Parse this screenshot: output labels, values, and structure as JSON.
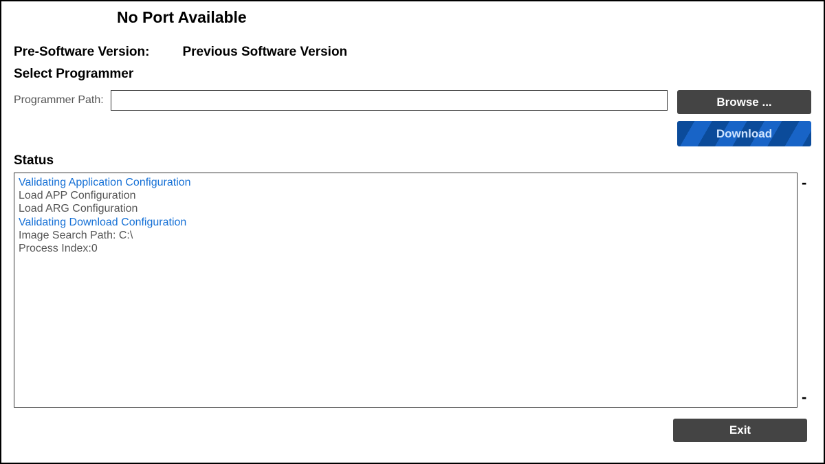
{
  "port_title": "No Port Available",
  "version": {
    "label": "Pre-Software Version:",
    "value": "Previous Software Version"
  },
  "select_programmer": {
    "heading": "Select Programmer",
    "path_label": "Programmer Path:",
    "path_value": ""
  },
  "buttons": {
    "browse": "Browse ...",
    "download": "Download",
    "exit": "Exit"
  },
  "status": {
    "heading": "Status",
    "lines": [
      {
        "text": "Validating Application Configuration",
        "highlight": true
      },
      {
        "text": "Load APP Configuration",
        "highlight": false
      },
      {
        "text": "Load ARG Configuration",
        "highlight": false
      },
      {
        "text": "Validating Download Configuration",
        "highlight": true
      },
      {
        "text": "Image Search Path: C:\\",
        "highlight": false
      },
      {
        "text": "Process Index:0",
        "highlight": false
      }
    ],
    "dash_top": "-",
    "dash_bottom": "-"
  }
}
